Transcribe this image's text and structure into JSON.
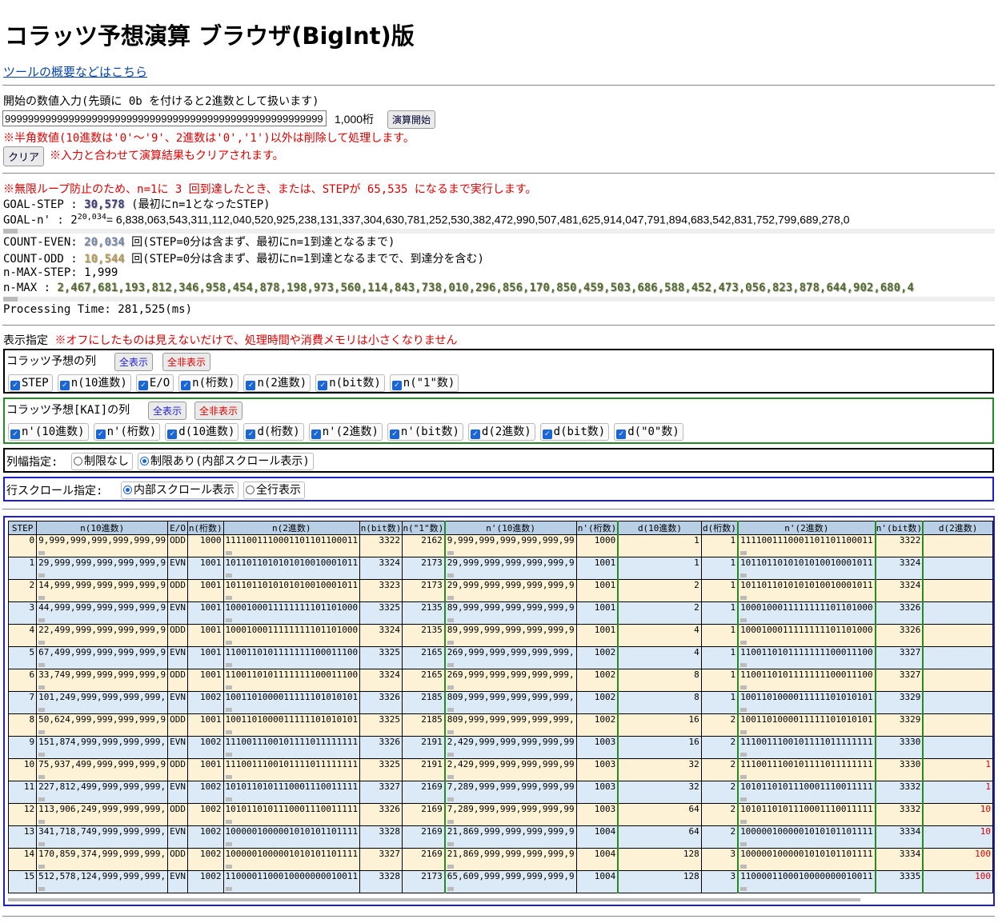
{
  "title": "コラッツ予想演算 ブラウザ(BigInt)版",
  "overview_link": "ツールの概要などはこちら",
  "input": {
    "label": "開始の数値入力(先頭に 0b を付けると2進数として扱います)",
    "value": "9999999999999999999999999999999999999999999999999999999",
    "digits": "1,000桁",
    "run_button": "演算開始",
    "warning": "※半角数値(10進数は'0'～'9'、2進数は'0','1')以外は削除して処理します。",
    "clear_button": "クリア",
    "clear_note": "※入力と合わせて演算結果もクリアされます。"
  },
  "result": {
    "loop_note": "※無限ループ防止のため、n=1に 3 回到達したとき、または、STEPが 65,535 になるまで実行します。",
    "goal_step_label": "GOAL-STEP :",
    "goal_step_value": "30,578",
    "goal_step_note": "(最初にn=1となったSTEP)",
    "goal_n_label": "GOAL-n'   :",
    "goal_n_base": "2",
    "goal_n_exp": "20,034",
    "goal_n_value": "= 6,838,063,543,311,112,040,520,925,238,131,337,304,630,781,252,530,382,472,990,507,481,625,914,047,791,894,683,542,831,752,799,689,278,0",
    "count_even_label": "COUNT-EVEN:",
    "count_even_value": "20,034",
    "count_even_note": "回(STEP=0分は含まず、最初にn=1到達となるまで)",
    "count_odd_label": "COUNT-ODD :",
    "count_odd_value": "10,544",
    "count_odd_note": "回(STEP=0分は含まず、最初にn=1到達となるまでで、到達分を含む)",
    "nmax_step_label": "n-MAX-STEP:",
    "nmax_step_value": "1,999",
    "nmax_label": "n-MAX     :",
    "nmax_value": "2,467,681,193,812,346,958,454,878,198,973,560,114,843,738,010,296,856,170,850,459,503,686,588,452,473,056,823,878,644,902,680,4",
    "processing_time": "Processing Time: 281,525(ms)"
  },
  "display": {
    "label": "表示指定",
    "note": "※オフにしたものは見えないだけで、処理時間や消費メモリは小さくなりません",
    "collatz_cols_label": "コラッツ予想の列",
    "show_all": "全表示",
    "hide_all": "全非表示",
    "collatz_cols": [
      "STEP",
      "n(10進数)",
      "E/O",
      "n(桁数)",
      "n(2進数)",
      "n(bit数)",
      "n(\"1\"数)"
    ],
    "kai_cols_label": "コラッツ予想[KAI]の列",
    "kai_cols": [
      "n'(10進数)",
      "n'(桁数)",
      "d(10進数)",
      "d(桁数)",
      "n'(2進数)",
      "n'(bit数)",
      "d(2進数)",
      "d(bit数)",
      "d(\"0\"数)"
    ],
    "col_width_label": "列幅指定:",
    "col_width_opts": [
      "制限なし",
      "制限あり(内部スクロール表示)"
    ],
    "row_scroll_label": "行スクロール指定:",
    "row_scroll_opts": [
      "内部スクロール表示",
      "全行表示"
    ]
  },
  "table": {
    "headers": [
      "STEP",
      "n(10進数)",
      "E/O",
      "n(桁数)",
      "n(2進数)",
      "n(bit数)",
      "n(\"1\"数)",
      "n'(10進数)",
      "n'(桁数)",
      "d(10進数)",
      "d(桁数)",
      "n'(2進数)",
      "n'(bit数)",
      "d(2進数)"
    ],
    "rows": [
      [
        "0",
        "9,999,999,999,999,999,99",
        "ODD",
        "1000",
        "1111001110001101101100011",
        "3322",
        "2162",
        "9,999,999,999,999,999,99",
        "1000",
        "1",
        "1",
        "1111001110001101101100011",
        "3322",
        ""
      ],
      [
        "1",
        "29,999,999,999,999,999,9",
        "EVN",
        "1001",
        "1011011010101010010001011",
        "3324",
        "2173",
        "29,999,999,999,999,999,9",
        "1001",
        "1",
        "1",
        "1011011010101010010001011",
        "3324",
        ""
      ],
      [
        "2",
        "14,999,999,999,999,999,9",
        "ODD",
        "1001",
        "1011011010101010010001011",
        "3323",
        "2173",
        "29,999,999,999,999,999,9",
        "1001",
        "2",
        "1",
        "1011011010101010010001011",
        "3324",
        ""
      ],
      [
        "3",
        "44,999,999,999,999,999,9",
        "EVN",
        "1001",
        "1000100011111111101101000",
        "3325",
        "2135",
        "89,999,999,999,999,999,9",
        "1001",
        "2",
        "1",
        "1000100011111111101101000",
        "3326",
        ""
      ],
      [
        "4",
        "22,499,999,999,999,999,9",
        "ODD",
        "1001",
        "1000100011111111101101000",
        "3324",
        "2135",
        "89,999,999,999,999,999,9",
        "1001",
        "4",
        "1",
        "1000100011111111101101000",
        "3326",
        ""
      ],
      [
        "5",
        "67,499,999,999,999,999,9",
        "EVN",
        "1001",
        "1100110101111111100011100",
        "3325",
        "2165",
        "269,999,999,999,999,999,",
        "1002",
        "4",
        "1",
        "1100110101111111100011100",
        "3327",
        ""
      ],
      [
        "6",
        "33,749,999,999,999,999,9",
        "ODD",
        "1001",
        "1100110101111111100011100",
        "3324",
        "2165",
        "269,999,999,999,999,999,",
        "1002",
        "8",
        "1",
        "1100110101111111100011100",
        "3327",
        ""
      ],
      [
        "7",
        "101,249,999,999,999,999,",
        "EVN",
        "1002",
        "1001101000011111101010101",
        "3326",
        "2185",
        "809,999,999,999,999,999,",
        "1002",
        "8",
        "1",
        "1001101000011111101010101",
        "3329",
        ""
      ],
      [
        "8",
        "50,624,999,999,999,999,9",
        "ODD",
        "1001",
        "1001101000011111101010101",
        "3325",
        "2185",
        "809,999,999,999,999,999,",
        "1002",
        "16",
        "2",
        "1001101000011111101010101",
        "3329",
        ""
      ],
      [
        "9",
        "151,874,999,999,999,999,",
        "EVN",
        "1002",
        "1110011100101111011111111",
        "3326",
        "2191",
        "2,429,999,999,999,999,99",
        "1003",
        "16",
        "2",
        "1110011100101111011111111",
        "3330",
        ""
      ],
      [
        "10",
        "75,937,499,999,999,999,9",
        "ODD",
        "1001",
        "1110011100101111011111111",
        "3325",
        "2191",
        "2,429,999,999,999,999,99",
        "1003",
        "32",
        "2",
        "1110011100101111011111111",
        "3330",
        "1"
      ],
      [
        "11",
        "227,812,499,999,999,999,",
        "EVN",
        "1002",
        "1010110101110001110011111",
        "3327",
        "2169",
        "7,289,999,999,999,999,99",
        "1003",
        "32",
        "2",
        "1010110101110001110011111",
        "3332",
        "1"
      ],
      [
        "12",
        "113,906,249,999,999,999,",
        "ODD",
        "1002",
        "1010110101110001110011111",
        "3326",
        "2169",
        "7,289,999,999,999,999,99",
        "1003",
        "64",
        "2",
        "1010110101110001110011111",
        "3332",
        "10"
      ],
      [
        "13",
        "341,718,749,999,999,999,",
        "EVN",
        "1002",
        "1000001000001010101101111",
        "3328",
        "2169",
        "21,869,999,999,999,999,9",
        "1004",
        "64",
        "2",
        "1000001000001010101101111",
        "3334",
        "10"
      ],
      [
        "14",
        "170,859,374,999,999,999,",
        "ODD",
        "1002",
        "1000001000001010101101111",
        "3327",
        "2169",
        "21,869,999,999,999,999,9",
        "1004",
        "128",
        "3",
        "1000001000001010101101111",
        "3334",
        "100"
      ],
      [
        "15",
        "512,578,124,999,999,999,",
        "EVN",
        "1002",
        "1100001100010000000010011",
        "3328",
        "2173",
        "65,609,999,999,999,999,9",
        "1004",
        "128",
        "3",
        "1100001100010000000010011",
        "3335",
        "100"
      ]
    ]
  }
}
